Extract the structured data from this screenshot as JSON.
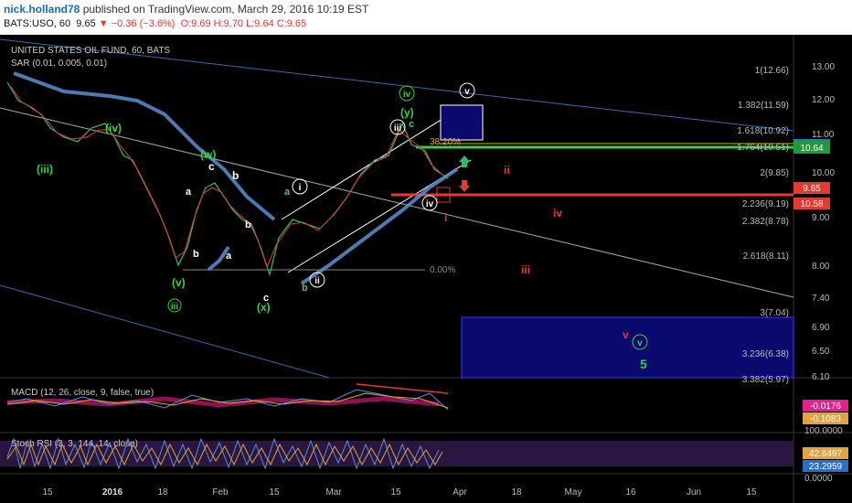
{
  "header": {
    "author": "nick.holland78",
    "published": "published on TradingView.com, March 29, 2016 10:19 EST",
    "symbol_line_prefix": "BATS:USO, 60",
    "last": "9.65",
    "change": "−0.36 (−3.6%)",
    "ohlc": "O:9.69 H:9.70 L:9.64 C:9.65"
  },
  "main_legend": {
    "title": "UNITED STATES OIL FUND, 60, BATS",
    "sar": "SAR (0.01, 0.005, 0.01)"
  },
  "price_axis": [
    "13.00",
    "12.00",
    "11.00",
    "10.00",
    "9.00",
    "8.00",
    "7.40",
    "6.90",
    "6.50",
    "6.10"
  ],
  "price_badges": {
    "last": "10.64",
    "current": "9.65",
    "other": "10.58"
  },
  "fib_labels": [
    "1(12.66)",
    "1.382(11.59)",
    "1.618(10.92)",
    "1.764(10.51)",
    "2(9.85)",
    "2.236(9.19)",
    "2.382(8.78)",
    "2.618(8.11)",
    "3(7.04)",
    "3.236(6.38)",
    "3.382(5.97)"
  ],
  "retrace_labels": [
    "38.20%",
    "0.00%"
  ],
  "waves": {
    "green": [
      "(iii)",
      "(iv)",
      "(v)",
      "iii",
      "(w)",
      "(x)",
      "(y)",
      "iv",
      "a",
      "b",
      "c",
      "5",
      "v"
    ],
    "white": [
      "c",
      "b",
      "a",
      "b",
      "a",
      "b",
      "c",
      "i",
      "ii",
      "iii",
      "iv",
      "v"
    ],
    "red": [
      "ii",
      "i",
      "iv",
      "iii",
      "v"
    ]
  },
  "macd": {
    "title": "MACD (12, 26, close, 9, false, true)",
    "v1": "-0.0176",
    "v2": "-0.1083"
  },
  "stoch": {
    "title": "Stoch RSI (3, 3, 144, 14, close)",
    "top": "100.0000",
    "v1": "42.6497",
    "v2": "23.2959",
    "bottom": "0.0000"
  },
  "time_axis": [
    "15",
    "2016",
    "18",
    "Feb",
    "15",
    "Mar",
    "15",
    "Apr",
    "18",
    "May",
    "16",
    "Jun",
    "15"
  ],
  "colors": {
    "up": "#2bbd6e",
    "down": "#e53935",
    "sar": "#5b8fd1",
    "green": "#3fce3f",
    "red": "#e53935",
    "navy": "#0a0a6e"
  }
}
